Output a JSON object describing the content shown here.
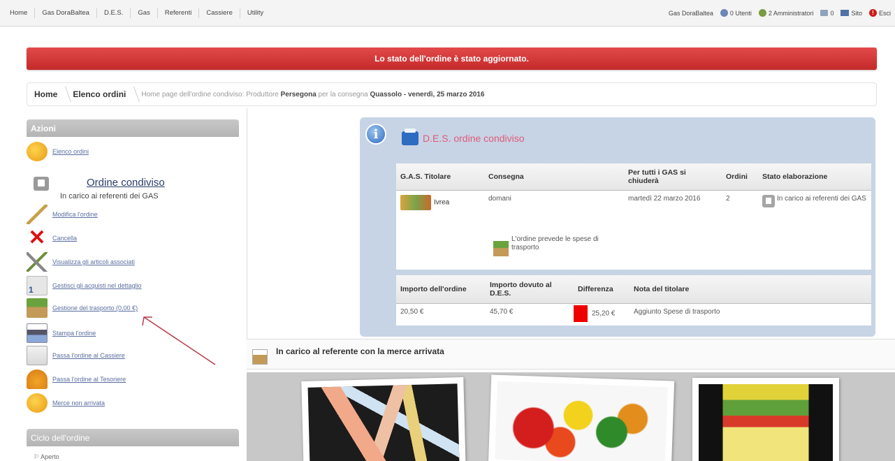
{
  "menu": [
    "Home",
    "Gas DoraBaltea",
    "D.E.S.",
    "Gas",
    "Referenti",
    "Cassiere",
    "Utility"
  ],
  "user_bar": {
    "gas": "Gas DoraBaltea",
    "utenti": "0 Utenti",
    "amministratori": "2 Amministratori",
    "mail_count": "0",
    "sito": "Sito",
    "esci": "Esci"
  },
  "alert": "Lo stato dell'ordine è stato aggiornato.",
  "breadcrumb": {
    "home": "Home",
    "elenco": "Elenco ordini",
    "current_prefix": "Home page dell'ordine condiviso: Produttore",
    "produttore": "Persegona",
    "mid": "per la consegna",
    "consegna": "Quassolo - venerdì, 25 marzo 2016"
  },
  "sidebar": {
    "title": "Azioni",
    "order_title": "Ordine condiviso",
    "order_sub": "In carico ai referenti dei GAS",
    "actions": {
      "elenco": "Elenco ordini",
      "modifica": "Modifica l'ordine",
      "cancella": "Cancella",
      "visualizza": "Visualizza gli articoli associati",
      "gestisci": "Gestisci gli acquisti nel dettaglio",
      "trasporto": "Gestione del trasporto (0,00 €)",
      "stampa": "Stampa l'ordine",
      "cassiere": "Passa l'ordine al Cassiere",
      "tesoriere": "Passa l'ordine al Tesoriere",
      "merce": "Merce non arrivata"
    },
    "cycle_title": "Ciclo dell'ordine",
    "cycle_item": "Aperto"
  },
  "des": {
    "title": "D.E.S. ordine condiviso",
    "headers": [
      "G.A.S. Titolare",
      "Consegna",
      "Per tutti i GAS si chiuderà",
      "Ordini",
      "Stato elaborazione"
    ],
    "row": {
      "gas": "Ivrea",
      "consegna": "domani",
      "chiusura": "martedì 22 marzo 2016",
      "ordini": "2",
      "stato": "In carico ai referenti dei GAS"
    },
    "transport_note": "L'ordine prevede le spese di trasporto",
    "totals_headers": [
      "Importo dell'ordine",
      "Importo dovuto al D.E.S.",
      "Differenza",
      "Nota del titolare"
    ],
    "totals_row": {
      "importo": "20,50 €",
      "dovuto": "45,70 €",
      "differenza": "25,20 €",
      "nota": "Aggiunto Spese di trasporto"
    }
  },
  "charge_title": "In carico al referente con la merce arrivata",
  "icons": [
    "info-icon",
    "box-icon",
    "lock-icon",
    "user-icon",
    "admin-icon",
    "mail-icon",
    "site-icon",
    "exit-icon"
  ],
  "colors": {
    "alert": "#c42a2a",
    "panel": "#c7d4e5",
    "diff_red": "#ef0000",
    "des_title": "#e05a7a"
  }
}
